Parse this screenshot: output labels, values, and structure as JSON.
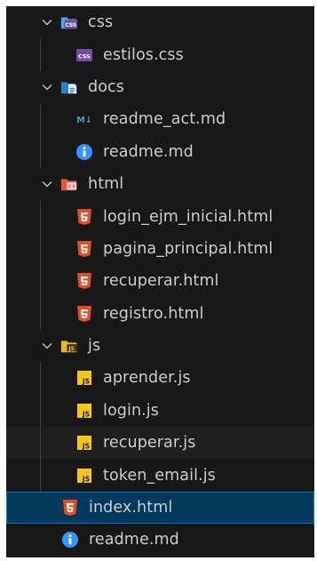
{
  "explorer": {
    "folders": {
      "css": "css",
      "docs": "docs",
      "html": "html",
      "js": "js"
    },
    "files": {
      "estilos_css": "estilos.css",
      "readme_act_md": "readme_act.md",
      "docs_readme_md": "readme.md",
      "login_ejm_inicial_html": "login_ejm_inicial.html",
      "pagina_principal_html": "pagina_principal.html",
      "recuperar_html": "recuperar.html",
      "registro_html": "registro.html",
      "aprender_js": "aprender.js",
      "login_js": "login.js",
      "recuperar_js": "recuperar.js",
      "token_email_js": "token_email.js",
      "index_html": "index.html",
      "root_readme_md": "readme.md"
    },
    "icon_glyphs": {
      "markdown": "M↓",
      "js": "JS",
      "css": "CSS"
    },
    "colors": {
      "background": "#181818",
      "text": "#cccccc",
      "selected_bg": "#04395e",
      "selected_border": "#0078d4",
      "html_icon": "#e44d26",
      "info_icon": "#3794ff",
      "js_icon": "#f5c518",
      "css_icon": "#6e4ea8",
      "markdown_icon": "#519aba"
    }
  }
}
